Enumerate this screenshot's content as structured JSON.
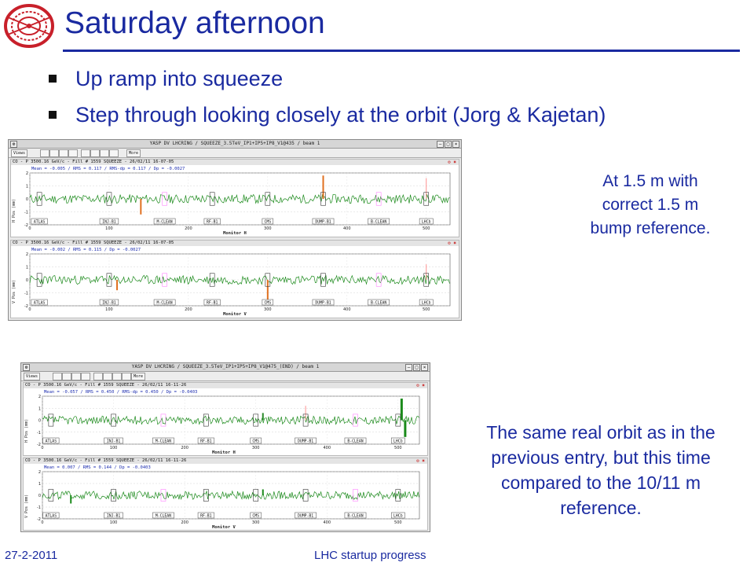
{
  "slide": {
    "title": "Saturday afternoon",
    "bullets": [
      "Up ramp into squeeze",
      "Step through looking closely at the orbit (Jorg & Kajetan)"
    ],
    "note1": "At 1.5 m with correct 1.5 m bump reference.",
    "note2": "The same real orbit as in the previous entry, but this time compared to the 10/11 m reference.",
    "footer_date": "27-2-2011",
    "footer_title": "LHC startup progress",
    "colors": {
      "title": "#1a2aa0",
      "trace": "#1a8a1a",
      "marker": "#ff80ff"
    }
  },
  "window1": {
    "title": "YASP DV LHCRING / SQUEEZE_3.5TeV_IP1+IP5+IP8_V1@435 / beam 1",
    "views_label": "Views",
    "more_label": "More",
    "panel_h": {
      "header": "CO - P 3500.16 GeV/c - Fill # 1559 SQUEEZE - 26/02/11 16-07-05",
      "stats": "Mean = -0.005 / RMS = 0.117 / RMS-dp = 0.117 / Dp = -0.0027",
      "ylabel": "H Pos (mm)",
      "xlabel": "Monitor H"
    },
    "panel_v": {
      "header": "CO - P 3500.16 GeV/c - Fill # 1559 SQUEEZE - 26/02/11 16-07-05",
      "stats": "Mean = -0.002 / RMS = 0.115 / Dp = -0.0027",
      "ylabel": "V Pos (mm)",
      "xlabel": "Monitor V"
    }
  },
  "window2": {
    "title": "YASP DV LHCRING / SQUEEZE_3.5TeV_IP1+IP5+IP8_V1@475_(END) / beam 1",
    "views_label": "Views",
    "more_label": "More",
    "panel_h": {
      "header": "CO - P 3500.16 GeV/c - Fill # 1559 SQUEEZE - 26/02/11 16-11-26",
      "stats": "Mean = -0.057 / RMS = 0.450 / RMS-dp = 0.450 / Dp = -0.0403",
      "ylabel": "H Pos (mm)",
      "xlabel": "Monitor H"
    },
    "panel_v": {
      "header": "CO - P 3500.16 GeV/c - Fill # 1559 SQUEEZE - 26/02/11 16-11-26",
      "stats": "Mean = 0.007 / RMS = 0.144 / Dp = -0.0403",
      "ylabel": "V Pos (mm)",
      "xlabel": "Monitor V"
    }
  },
  "plot_common": {
    "ylim": [
      -2,
      2
    ],
    "yticks": [
      "2",
      "1",
      "0",
      "-1",
      "-2"
    ],
    "xlim": [
      0,
      530
    ],
    "xticks": [
      "0",
      "100",
      "200",
      "300",
      "400",
      "500"
    ],
    "ip_labels": [
      "ATLAS",
      "INJ-B1",
      "M-CLEAN",
      "RF-B1",
      "CMS",
      "DUMP-B1",
      "B-CLEAN",
      "LHCb"
    ]
  }
}
